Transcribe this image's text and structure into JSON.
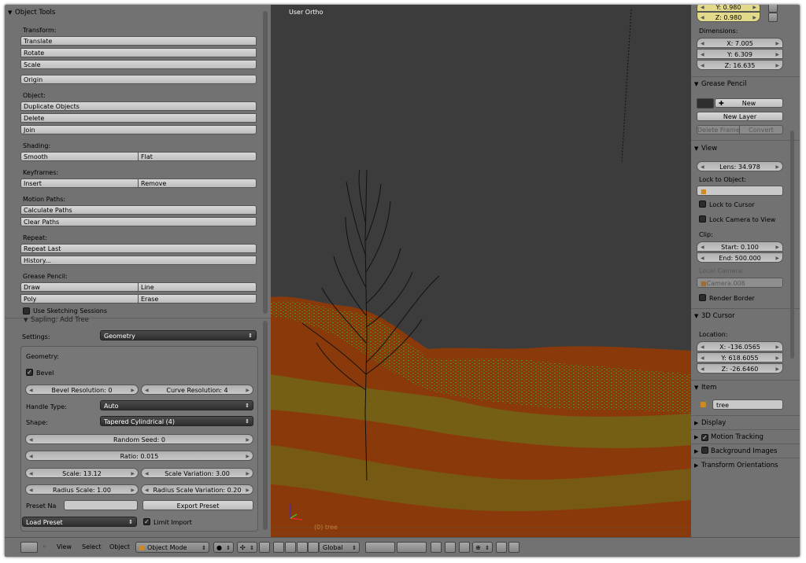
{
  "toolshelf": {
    "title": "Object Tools",
    "transform_label": "Transform:",
    "translate": "Translate",
    "rotate": "Rotate",
    "scale": "Scale",
    "origin": "Origin",
    "object_label": "Object:",
    "duplicate": "Duplicate Objects",
    "delete": "Delete",
    "join": "Join",
    "shading_label": "Shading:",
    "smooth": "Smooth",
    "flat": "Flat",
    "keyframes_label": "Keyframes:",
    "insert": "Insert",
    "remove": "Remove",
    "motion_paths_label": "Motion Paths:",
    "calc_paths": "Calculate Paths",
    "clear_paths": "Clear Paths",
    "repeat_label": "Repeat:",
    "repeat_last": "Repeat Last",
    "history": "History...",
    "grease_label": "Grease Pencil:",
    "draw": "Draw",
    "line": "Line",
    "poly": "Poly",
    "erase": "Erase",
    "use_sketching": "Use Sketching Sessions"
  },
  "operator": {
    "title": "Sapling: Add Tree",
    "settings_label": "Settings:",
    "settings_value": "Geometry",
    "geometry_label": "Geometry:",
    "bevel_label": "Bevel",
    "bevel_checked": true,
    "bevel_resolution": "Bevel Resolution: 0",
    "curve_resolution": "Curve Resolution: 4",
    "handle_type_label": "Handle Type:",
    "handle_type_value": "Auto",
    "shape_label": "Shape:",
    "shape_value": "Tapered Cylindrical (4)",
    "random_seed": "Random Seed: 0",
    "ratio": "Ratio: 0.015",
    "scale": "Scale: 13.12",
    "scale_variation": "Scale Variation: 3.00",
    "radius_scale": "Radius Scale: 1.00",
    "radius_scale_variation": "Radius Scale Variation: 0.20",
    "preset_name_label": "Preset Na",
    "preset_name_value": "",
    "export_preset": "Export Preset",
    "load_preset": "Load Preset",
    "limit_import": "Limit Import",
    "limit_import_checked": true
  },
  "viewport": {
    "view_name": "User Ortho",
    "object_label": "(0) tree"
  },
  "properties": {
    "y_scale": "Y: 0.980",
    "z_scale": "Z: 0.980",
    "dimensions_label": "Dimensions:",
    "dim_x": "X: 7.005",
    "dim_y": "Y: 6.309",
    "dim_z": "Z: 16.635",
    "grease_pencil_title": "Grease Pencil",
    "gp_new": "New",
    "gp_new_layer": "New Layer",
    "gp_delete_frame": "Delete Frame",
    "gp_convert": "Convert",
    "view_title": "View",
    "lens": "Lens: 34.978",
    "lock_to_object_label": "Lock to Object:",
    "lock_to_cursor": "Lock to Cursor",
    "lock_camera_to_view": "Lock Camera to View",
    "clip_label": "Clip:",
    "clip_start": "Start: 0.100",
    "clip_end": "End: 500.000",
    "local_camera_label": "Local Camera:",
    "local_camera_value": "Camera.008",
    "render_border": "Render Border",
    "cursor_title": "3D Cursor",
    "location_label": "Location:",
    "cursor_x": "X: -136.0565",
    "cursor_y": "Y: 618.6055",
    "cursor_z": "Z: -26.6460",
    "item_title": "Item",
    "item_name": "tree",
    "display_title": "Display",
    "motion_tracking": "Motion Tracking",
    "motion_tracking_checked": true,
    "background_images": "Background Images",
    "background_images_checked": false,
    "transform_orientations": "Transform Orientations"
  },
  "header": {
    "view": "View",
    "select": "Select",
    "object": "Object",
    "mode": "Object Mode",
    "orientation": "Global"
  },
  "colors": {
    "panel": "#727272",
    "viewport_bg": "#3c3c3c",
    "terrain_brown": "#8a3a0a",
    "terrain_green": "#4aa52a",
    "active_field": "#e3d98a"
  }
}
